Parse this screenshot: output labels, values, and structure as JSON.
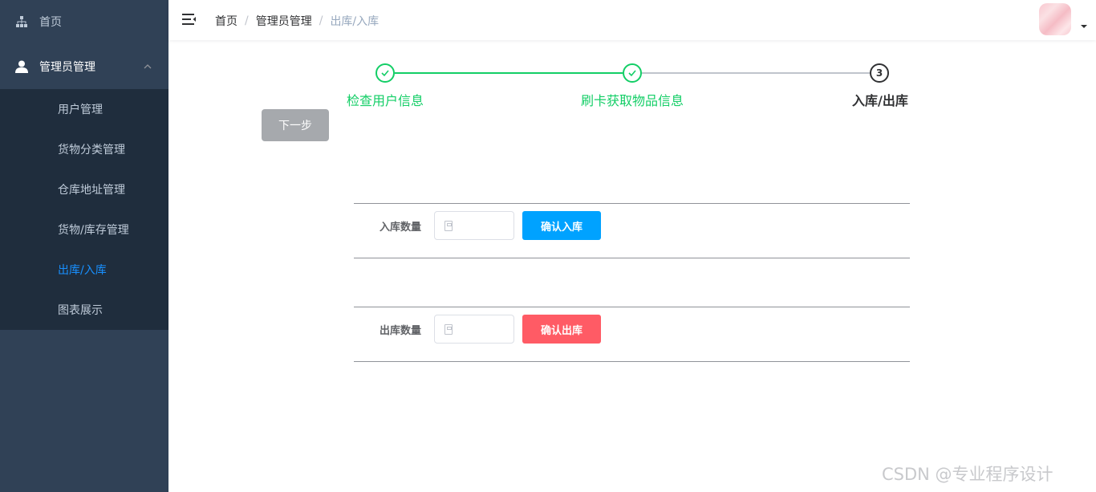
{
  "sidebar": {
    "home_label": "首页",
    "admin_label": "管理员管理",
    "items": [
      {
        "label": "用户管理"
      },
      {
        "label": "货物分类管理"
      },
      {
        "label": "仓库地址管理"
      },
      {
        "label": "货物/库存管理"
      },
      {
        "label": "出库/入库",
        "active": true
      },
      {
        "label": "图表展示"
      }
    ]
  },
  "navbar": {
    "breadcrumb": [
      "首页",
      "管理员管理",
      "出库/入库"
    ],
    "separator": "/"
  },
  "steps": [
    {
      "title": "检查用户信息",
      "status": "success"
    },
    {
      "title": "刷卡获取物品信息",
      "status": "success"
    },
    {
      "title": "入库/出库",
      "status": "process",
      "number": "3"
    }
  ],
  "next_button": "下一步",
  "stock_in": {
    "label": "入库数量",
    "value": "",
    "button": "确认入库"
  },
  "stock_out": {
    "label": "出库数量",
    "value": "",
    "button": "确认出库"
  },
  "watermark": "CSDN @专业程序设计",
  "colors": {
    "sidebar_bg": "#304156",
    "submenu_bg": "#1f2d3d",
    "active": "#1890ff",
    "success": "#13ce66",
    "btn_in": "#00a2ff",
    "btn_out": "#ff5b65"
  }
}
